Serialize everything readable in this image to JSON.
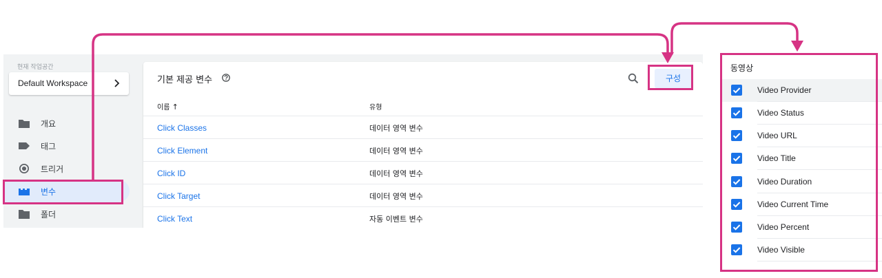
{
  "colors": {
    "accent": "#1a73e8",
    "highlight": "#d63384",
    "active_bg": "#e1ebfb"
  },
  "workspace": {
    "label": "현재 작업공간",
    "name": "Default Workspace",
    "chevron_icon": "chevron-right-icon"
  },
  "nav": [
    {
      "label": "개요",
      "icon": "overview-folder-icon",
      "active": false
    },
    {
      "label": "태그",
      "icon": "tag-icon",
      "active": false
    },
    {
      "label": "트리거",
      "icon": "trigger-icon",
      "active": false
    },
    {
      "label": "변수",
      "icon": "variables-icon",
      "active": true
    },
    {
      "label": "폴더",
      "icon": "folder-icon",
      "active": false
    }
  ],
  "builtin": {
    "title": "기본 제공 변수",
    "help_icon": "help-circle-icon",
    "search_icon": "search-icon",
    "configure_label": "구성",
    "col_name": "이름",
    "col_name_sort": "↑",
    "col_type": "유형",
    "rows": [
      {
        "name": "Click Classes",
        "type": "데이터 영역 변수"
      },
      {
        "name": "Click Element",
        "type": "데이터 영역 변수"
      },
      {
        "name": "Click ID",
        "type": "데이터 영역 변수"
      },
      {
        "name": "Click Target",
        "type": "데이터 영역 변수"
      },
      {
        "name": "Click Text",
        "type": "자동 이벤트 변수"
      }
    ]
  },
  "video": {
    "title": "동영상",
    "items": [
      {
        "label": "Video Provider",
        "checked": true
      },
      {
        "label": "Video Status",
        "checked": true
      },
      {
        "label": "Video URL",
        "checked": true
      },
      {
        "label": "Video Title",
        "checked": true
      },
      {
        "label": "Video Duration",
        "checked": true
      },
      {
        "label": "Video Current Time",
        "checked": true
      },
      {
        "label": "Video Percent",
        "checked": true
      },
      {
        "label": "Video Visible",
        "checked": true
      }
    ]
  }
}
